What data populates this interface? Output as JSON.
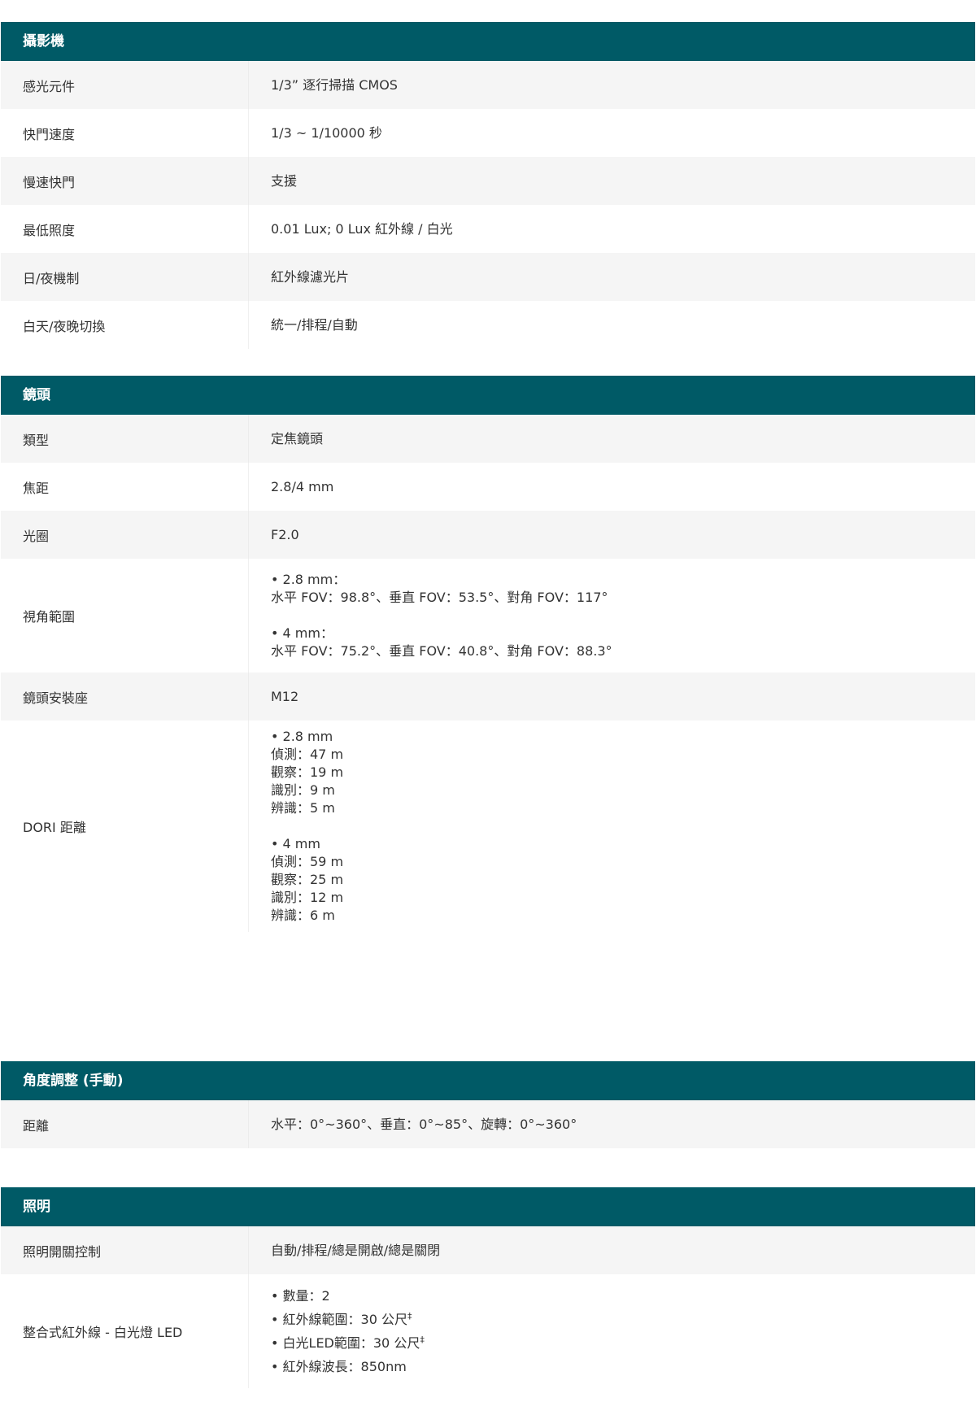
{
  "sections": {
    "camera": {
      "title": "攝影機",
      "rows": [
        {
          "label": "感光元件",
          "value": "1/3” 逐行掃描 CMOS"
        },
        {
          "label": "快門速度",
          "value": "1/3 ~ 1/10000 秒"
        },
        {
          "label": "慢速快門",
          "value": "支援"
        },
        {
          "label": "最低照度",
          "value": "0.01 Lux; 0 Lux 紅外線 / 白光"
        },
        {
          "label": "日/夜機制",
          "value": "紅外線濾光片"
        },
        {
          "label": "白天/夜晚切換",
          "value": "統一/排程/自動"
        }
      ]
    },
    "lens": {
      "title": "鏡頭",
      "rows": [
        {
          "label": "類型",
          "value": "定焦鏡頭"
        },
        {
          "label": "焦距",
          "value": "2.8/4 mm"
        },
        {
          "label": "光圈",
          "value": "F2.0"
        },
        {
          "label": "視角範圍",
          "lines": [
            "• 2.8 mm：",
            "水平 FOV：98.8°、垂直 FOV：53.5°、對角 FOV：117°",
            "• 4 mm：",
            "水平 FOV：75.2°、垂直 FOV：40.8°、對角 FOV：88.3°"
          ]
        },
        {
          "label": "鏡頭安裝座",
          "value": "M12"
        },
        {
          "label": "DORI 距離",
          "lines": [
            "• 2.8 mm",
            "偵測：47 m",
            "觀察：19 m",
            "識別：9 m",
            "辨識：5 m",
            "• 4 mm",
            "偵測：59 m",
            "觀察：25 m",
            "識別：12 m",
            "辨識：6 m"
          ]
        }
      ]
    },
    "angle": {
      "title": "角度調整 (手動)",
      "rows": [
        {
          "label": "距離",
          "value": "水平：0°~360°、垂直：0°~85°、旋轉：0°~360°"
        }
      ]
    },
    "lighting": {
      "title": "照明",
      "rows": [
        {
          "label": "照明開關控制",
          "value": "自動/排程/總是開啟/總是關閉"
        },
        {
          "label": "整合式紅外線 - 白光燈 LED",
          "lines": [
            "• 數量：2",
            "• 紅外線範圍：30 公尺",
            "• 白光LED範圍：30 公尺",
            "• 紅外線波長：850nm"
          ],
          "footnote_mark": "‡"
        }
      ]
    }
  }
}
